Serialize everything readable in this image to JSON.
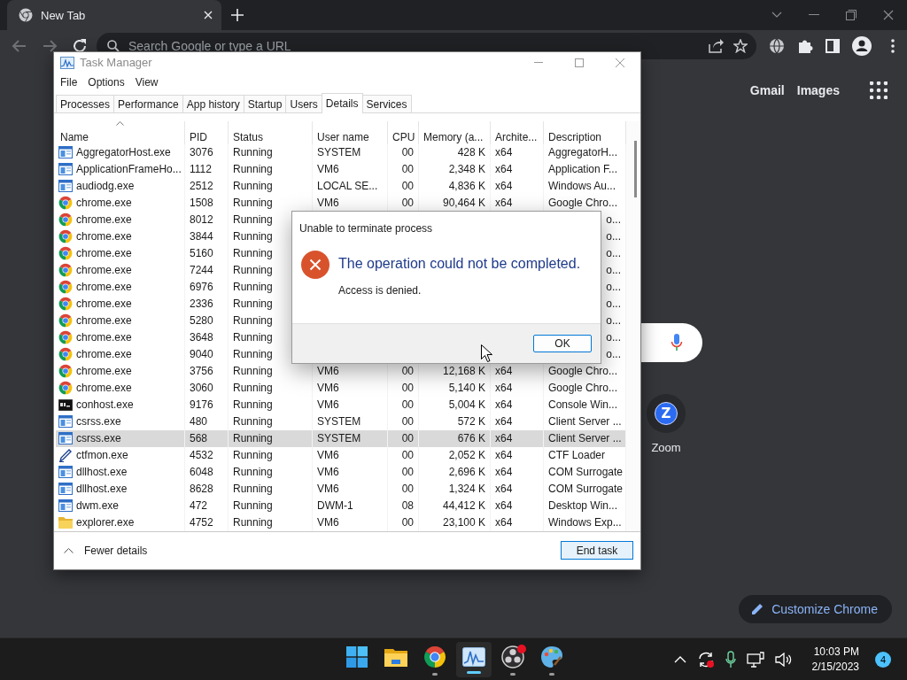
{
  "browser": {
    "tab": {
      "title": "New Tab"
    },
    "omnibox": {
      "placeholder": "Search Google or type a URL"
    },
    "header_links": [
      "Gmail",
      "Images"
    ],
    "shortcut": {
      "logo": "Z",
      "label": "Zoom"
    },
    "customize_button": "Customize Chrome"
  },
  "task_manager": {
    "title": "Task Manager",
    "menu": [
      "File",
      "Options",
      "View"
    ],
    "tabs": [
      {
        "label": "Processes",
        "selected": false
      },
      {
        "label": "Performance",
        "selected": false
      },
      {
        "label": "App history",
        "selected": false
      },
      {
        "label": "Startup",
        "selected": false
      },
      {
        "label": "Users",
        "selected": false
      },
      {
        "label": "Details",
        "selected": true
      },
      {
        "label": "Services",
        "selected": false
      }
    ],
    "columns": [
      {
        "label": "Name",
        "sorted": true
      },
      {
        "label": "PID",
        "sorted": false
      },
      {
        "label": "Status",
        "sorted": false
      },
      {
        "label": "User name",
        "sorted": false
      },
      {
        "label": "CPU",
        "sorted": false
      },
      {
        "label": "Memory (a...",
        "sorted": false
      },
      {
        "label": "Archite...",
        "sorted": false
      },
      {
        "label": "Description",
        "sorted": false
      }
    ],
    "rows": [
      {
        "kind": "app",
        "name": "AggregatorHost.exe",
        "pid": "3076",
        "status": "Running",
        "user": "SYSTEM",
        "cpu": "00",
        "memory": "428 K",
        "arch": "x64",
        "description": "AggregatorH...",
        "selected": false
      },
      {
        "kind": "app",
        "name": "ApplicationFrameHo...",
        "pid": "1112",
        "status": "Running",
        "user": "VM6",
        "cpu": "00",
        "memory": "2,348 K",
        "arch": "x64",
        "description": "Application F...",
        "selected": false
      },
      {
        "kind": "app",
        "name": "audiodg.exe",
        "pid": "2512",
        "status": "Running",
        "user": "LOCAL SE...",
        "cpu": "00",
        "memory": "4,836 K",
        "arch": "x64",
        "description": "Windows Au...",
        "selected": false
      },
      {
        "kind": "chrome",
        "name": "chrome.exe",
        "pid": "1508",
        "status": "Running",
        "user": "VM6",
        "cpu": "00",
        "memory": "90,464 K",
        "arch": "x64",
        "description": "Google Chro...",
        "selected": false
      },
      {
        "kind": "chrome",
        "name": "chrome.exe",
        "pid": "8012",
        "status": "Running",
        "description": "o...",
        "selected": false
      },
      {
        "kind": "chrome",
        "name": "chrome.exe",
        "pid": "3844",
        "status": "Running",
        "description": "o...",
        "selected": false
      },
      {
        "kind": "chrome",
        "name": "chrome.exe",
        "pid": "5160",
        "status": "Running",
        "description": "o...",
        "selected": false
      },
      {
        "kind": "chrome",
        "name": "chrome.exe",
        "pid": "7244",
        "status": "Running",
        "description": "o...",
        "selected": false
      },
      {
        "kind": "chrome",
        "name": "chrome.exe",
        "pid": "6976",
        "status": "Running",
        "description": "o...",
        "selected": false
      },
      {
        "kind": "chrome",
        "name": "chrome.exe",
        "pid": "2336",
        "status": "Running",
        "description": "o...",
        "selected": false
      },
      {
        "kind": "chrome",
        "name": "chrome.exe",
        "pid": "5280",
        "status": "Running",
        "description": "o...",
        "selected": false
      },
      {
        "kind": "chrome",
        "name": "chrome.exe",
        "pid": "3648",
        "status": "Running",
        "description": "o...",
        "selected": false
      },
      {
        "kind": "chrome",
        "name": "chrome.exe",
        "pid": "9040",
        "status": "Running",
        "description": "o...",
        "selected": false
      },
      {
        "kind": "chrome",
        "name": "chrome.exe",
        "pid": "3756",
        "status": "Running",
        "user": "VM6",
        "cpu": "00",
        "memory": "12,168 K",
        "arch": "x64",
        "description": "Google Chro...",
        "selected": false
      },
      {
        "kind": "chrome",
        "name": "chrome.exe",
        "pid": "3060",
        "status": "Running",
        "user": "VM6",
        "cpu": "00",
        "memory": "5,140 K",
        "arch": "x64",
        "description": "Google Chro...",
        "selected": false
      },
      {
        "kind": "console",
        "name": "conhost.exe",
        "pid": "9176",
        "status": "Running",
        "user": "VM6",
        "cpu": "00",
        "memory": "5,004 K",
        "arch": "x64",
        "description": "Console Win...",
        "selected": false
      },
      {
        "kind": "app",
        "name": "csrss.exe",
        "pid": "480",
        "status": "Running",
        "user": "SYSTEM",
        "cpu": "00",
        "memory": "572 K",
        "arch": "x64",
        "description": "Client Server ...",
        "selected": false
      },
      {
        "kind": "app",
        "name": "csrss.exe",
        "pid": "568",
        "status": "Running",
        "user": "SYSTEM",
        "cpu": "00",
        "memory": "676 K",
        "arch": "x64",
        "description": "Client Server ...",
        "selected": true
      },
      {
        "kind": "pen",
        "name": "ctfmon.exe",
        "pid": "4532",
        "status": "Running",
        "user": "VM6",
        "cpu": "00",
        "memory": "2,052 K",
        "arch": "x64",
        "description": "CTF Loader",
        "selected": false
      },
      {
        "kind": "app",
        "name": "dllhost.exe",
        "pid": "6048",
        "status": "Running",
        "user": "VM6",
        "cpu": "00",
        "memory": "2,696 K",
        "arch": "x64",
        "description": "COM Surrogate",
        "selected": false
      },
      {
        "kind": "app",
        "name": "dllhost.exe",
        "pid": "8628",
        "status": "Running",
        "user": "VM6",
        "cpu": "00",
        "memory": "1,324 K",
        "arch": "x64",
        "description": "COM Surrogate",
        "selected": false
      },
      {
        "kind": "app",
        "name": "dwm.exe",
        "pid": "472",
        "status": "Running",
        "user": "DWM-1",
        "cpu": "08",
        "memory": "44,412 K",
        "arch": "x64",
        "description": "Desktop Win...",
        "selected": false
      },
      {
        "kind": "folder",
        "name": "explorer.exe",
        "pid": "4752",
        "status": "Running",
        "user": "VM6",
        "cpu": "00",
        "memory": "23,100 K",
        "arch": "x64",
        "description": "Windows Exp...",
        "selected": false
      }
    ],
    "footer": {
      "toggle": "Fewer details",
      "button": "End task"
    }
  },
  "dialog": {
    "title": "Unable to terminate process",
    "heading": "The operation could not be completed.",
    "message": "Access is denied.",
    "button": "OK"
  },
  "taskbar": {
    "apps": [
      {
        "kind": "start",
        "running": false,
        "active": false,
        "alert": false
      },
      {
        "kind": "folder",
        "running": false,
        "active": false,
        "alert": false
      },
      {
        "kind": "chrome",
        "running": true,
        "active": false,
        "alert": false
      },
      {
        "kind": "taskmgr",
        "running": true,
        "active": true,
        "alert": false
      },
      {
        "kind": "obs",
        "running": true,
        "active": false,
        "alert": true
      },
      {
        "kind": "paint",
        "running": true,
        "active": false,
        "alert": false
      }
    ],
    "tray": {
      "time": "10:03 PM",
      "date": "2/15/2023",
      "notifications": "4"
    }
  }
}
